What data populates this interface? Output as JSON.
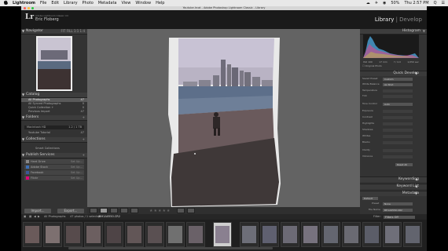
{
  "menubar": {
    "items": [
      "Lightroom",
      "File",
      "Edit",
      "Library",
      "Photo",
      "Metadata",
      "View",
      "Window",
      "Help"
    ],
    "right": [
      "☁",
      "✈",
      "◉",
      "50%",
      "Thu 2:57 PM",
      "Q",
      "☰"
    ]
  },
  "window": {
    "title": "Youtube.lrcat - Adobe Photoshop Lightroom Classic - Library"
  },
  "identity": {
    "logo": "Lr",
    "catalog_label": "Adobe Lightroom Classic CC",
    "user": "Eric Floberg",
    "modules": [
      "Library",
      "Develop"
    ],
    "active_module": "Library"
  },
  "left_panel": {
    "navigator": {
      "title": "Navigator",
      "options": "FIT  FILL  1:1  1:4"
    },
    "catalog": {
      "title": "Catalog",
      "items": [
        {
          "label": "All Photographs",
          "count": "47"
        },
        {
          "label": "All Synced Photographs",
          "count": "0"
        },
        {
          "label": "Quick Collection +",
          "count": "0"
        },
        {
          "label": "Previous Import",
          "count": "47"
        }
      ]
    },
    "folders": {
      "title": "Folders",
      "volume": "Macintosh HD",
      "volume_info": "1.2 / 1 TB",
      "folder": "Youtube Tutorial",
      "folder_count": "47"
    },
    "collections": {
      "title": "Collections",
      "item": "Smart Collections"
    },
    "publish": {
      "title": "Publish Services",
      "items": [
        {
          "label": "Hard Drive",
          "action": "Set Up...",
          "color": "#888888"
        },
        {
          "label": "Adobe Stock",
          "action": "Set Up...",
          "color": "#3b6fb6"
        },
        {
          "label": "Facebook",
          "action": "Set Up...",
          "color": "#3b5998"
        },
        {
          "label": "Flickr",
          "action": "Set Up...",
          "color": "#e0007a"
        }
      ]
    },
    "import_label": "Import...",
    "export_label": "Export..."
  },
  "right_panel": {
    "histogram": {
      "title": "Histogram",
      "iso": "ISO 100",
      "focal": "17 mm",
      "aperture": "f / 4.0",
      "shutter": "1/250 sec",
      "original": "Original Photo"
    },
    "quick_develop": {
      "title": "Quick Develop",
      "rows": [
        {
          "label": "Saved Preset",
          "value": "Custom"
        },
        {
          "label": "White Balance",
          "value": "As Shot"
        },
        {
          "label": "Temperature",
          "value": ""
        },
        {
          "label": "Tint",
          "value": ""
        },
        {
          "label": "Tone Control",
          "value": "Auto"
        },
        {
          "label": "Exposure",
          "value": ""
        },
        {
          "label": "Contrast",
          "value": ""
        },
        {
          "label": "Highlights",
          "value": ""
        },
        {
          "label": "Shadows",
          "value": ""
        },
        {
          "label": "Whites",
          "value": ""
        },
        {
          "label": "Blacks",
          "value": ""
        },
        {
          "label": "Clarity",
          "value": ""
        },
        {
          "label": "Vibrance",
          "value": ""
        }
      ],
      "reset_label": "Reset All"
    },
    "sections": [
      "Keywording",
      "Keyword List",
      "Metadata"
    ],
    "metadata": {
      "preset": "Default",
      "field1": "Preset",
      "field1_value": "None",
      "field2": "File Name",
      "field2_value": "BH1A0550.CR2"
    }
  },
  "filmstrip": {
    "source": "All Photographs",
    "count": "47 photos / 1 selected",
    "selected_file": "/BH1A0550.CR2",
    "filter_label": "Filter:",
    "filter_value": "Filters Off"
  },
  "colors": {
    "menubar": "#e8e8e8",
    "panel": "#333333",
    "center": "#636363",
    "accent": "#d9d9d9"
  }
}
